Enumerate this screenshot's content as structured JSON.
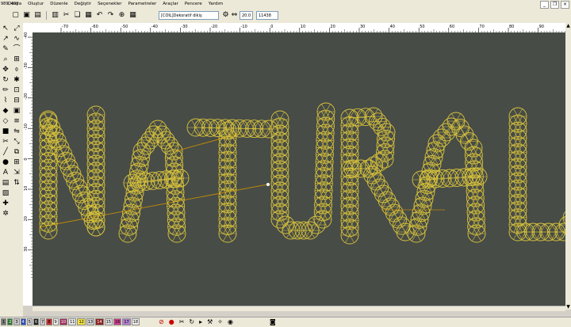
{
  "titlebar": {
    "coords": "989, 408"
  },
  "menu": [
    "Dosya",
    "Oluştur",
    "Düzenle",
    "Değiştir",
    "Seçenekler",
    "Parametreler",
    "Araçlar",
    "Pencere",
    "Yardım"
  ],
  "toolbar": {
    "pattern_select": "[COIL]Dekoratif dikiş",
    "stitch_length": "20.0",
    "stitch_count": "11438"
  },
  "rulers": {
    "h_ticks": [
      "-70",
      "-60",
      "-50",
      "-40",
      "-30",
      "-20",
      "-10",
      "0",
      "10",
      "20",
      "30",
      "40",
      "50",
      "60",
      "70",
      "80",
      "90"
    ],
    "v_ticks": [
      "-40",
      "-30",
      "-20",
      "-10",
      "0",
      "10",
      "20",
      "30"
    ]
  },
  "palette": {
    "swatches": [
      {
        "label": "1",
        "color": "#7a7a7a"
      },
      {
        "label": "2",
        "color": "#2a7a2a"
      },
      {
        "label": "3",
        "color": "#c8c8c8"
      },
      {
        "label": "4",
        "color": "#3050c0"
      },
      {
        "label": "5",
        "color": "#d0d0d0"
      },
      {
        "label": "6",
        "color": "#202020"
      },
      {
        "label": "7",
        "color": "#c8c8c8"
      },
      {
        "label": "8",
        "color": "#d03030"
      },
      {
        "label": "9",
        "color": "#f0f0f0"
      },
      {
        "label": "10",
        "color": "#a03060"
      },
      {
        "label": "11",
        "color": "#e8e8e8"
      },
      {
        "label": "12",
        "color": "#f0e040"
      },
      {
        "label": "13",
        "color": "#d0d0d0"
      },
      {
        "label": "14",
        "color": "#902020"
      },
      {
        "label": "15",
        "color": "#e0e0e0"
      },
      {
        "label": "16",
        "color": "#d04090"
      },
      {
        "label": "17",
        "color": "#b080d0"
      },
      {
        "label": "18",
        "color": "#f0f0f0"
      }
    ]
  },
  "canvas": {
    "background": "#474c47",
    "stitch_color": "#d8c23a",
    "guide_color": "#b8860b"
  }
}
